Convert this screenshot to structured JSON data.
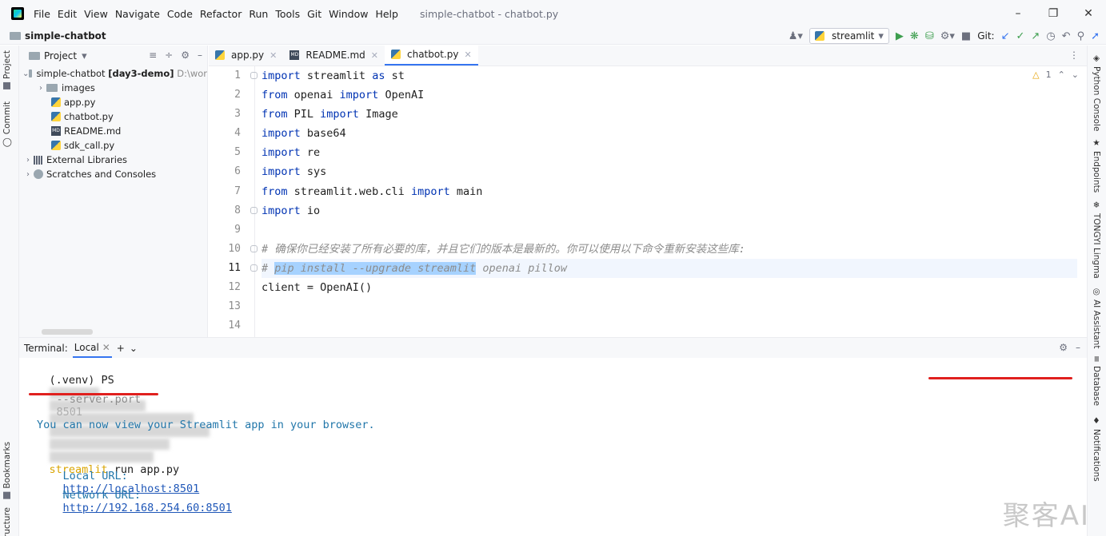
{
  "menu": {
    "items": [
      "File",
      "Edit",
      "View",
      "Navigate",
      "Code",
      "Refactor",
      "Run",
      "Tools",
      "Git",
      "Window",
      "Help"
    ],
    "window_title": "simple-chatbot - chatbot.py"
  },
  "navbar": {
    "project_name": "simple-chatbot",
    "run_config": "streamlit",
    "git_label": "Git:"
  },
  "left_strip": {
    "project": "Project",
    "commit": "Commit",
    "bookmarks": "Bookmarks",
    "structure": "ructure"
  },
  "right_strip": {
    "python_console": "Python Console",
    "endpoints": "Endpoints",
    "tongyi": "TONGYI Lingma",
    "ai_assistant": "AI Assistant",
    "database": "Database",
    "notifications": "Notifications"
  },
  "project_panel": {
    "title": "Project",
    "root": {
      "name": "simple-chatbot",
      "branch": "[day3-demo]",
      "path": "D:\\wor"
    },
    "items": [
      "images",
      "app.py",
      "chatbot.py",
      "README.md",
      "sdk_call.py"
    ],
    "external": "External Libraries",
    "scratches": "Scratches and Consoles"
  },
  "editor_tabs": [
    "app.py",
    "README.md",
    "chatbot.py"
  ],
  "editor": {
    "warning_count": "1",
    "line_numbers": [
      "1",
      "2",
      "3",
      "4",
      "5",
      "6",
      "7",
      "8",
      "9",
      "10",
      "11",
      "12",
      "13",
      "14"
    ],
    "current_line": 11,
    "lines": [
      [
        {
          "t": "import",
          "c": "kw"
        },
        {
          "t": " streamlit "
        },
        {
          "t": "as",
          "c": "kw"
        },
        {
          "t": " st"
        }
      ],
      [
        {
          "t": "from",
          "c": "kw"
        },
        {
          "t": " openai "
        },
        {
          "t": "import",
          "c": "kw"
        },
        {
          "t": " OpenAI"
        }
      ],
      [
        {
          "t": "from",
          "c": "kw"
        },
        {
          "t": " PIL "
        },
        {
          "t": "import",
          "c": "kw"
        },
        {
          "t": " Image"
        }
      ],
      [
        {
          "t": "import",
          "c": "kw"
        },
        {
          "t": " base64"
        }
      ],
      [
        {
          "t": "import",
          "c": "kw"
        },
        {
          "t": " re"
        }
      ],
      [
        {
          "t": "import",
          "c": "kw"
        },
        {
          "t": " sys"
        }
      ],
      [
        {
          "t": "from",
          "c": "kw"
        },
        {
          "t": " streamlit.web.cli "
        },
        {
          "t": "import",
          "c": "kw"
        },
        {
          "t": " main"
        }
      ],
      [
        {
          "t": "import",
          "c": "kw"
        },
        {
          "t": " io"
        }
      ],
      [],
      [
        {
          "t": "# 确保你已经安装了所有必要的库，并且它们的版本是最新的。你可以使用以下命令重新安装这些库:",
          "c": "cm"
        }
      ],
      [
        {
          "t": "# ",
          "c": "cm"
        },
        {
          "t": "pip install --upgrade streamlit",
          "c": "cm sel"
        },
        {
          "t": " openai pillow",
          "c": "cm"
        }
      ],
      [
        {
          "t": "client = OpenAI()"
        }
      ],
      [],
      []
    ]
  },
  "terminal": {
    "label": "Terminal:",
    "tab": "Local",
    "prompt": "(.venv) PS",
    "cmd_streamlit": "streamlit",
    "cmd_rest": " run app.py",
    "flag": "--server.port",
    "port": "8501",
    "info": "You can now view your Streamlit app in your browser.",
    "local_label": "Local URL:",
    "local_url": "http://localhost:8501",
    "network_label": "Network URL:",
    "network_url": "http://192.168.254.60:8501"
  },
  "watermark": "聚客AI",
  "colors": {
    "keyword": "#0033b3",
    "comment": "#8c8c8c",
    "selection": "#a6d2ff",
    "annotation": "#e0201e",
    "accent": "#3574f0"
  }
}
